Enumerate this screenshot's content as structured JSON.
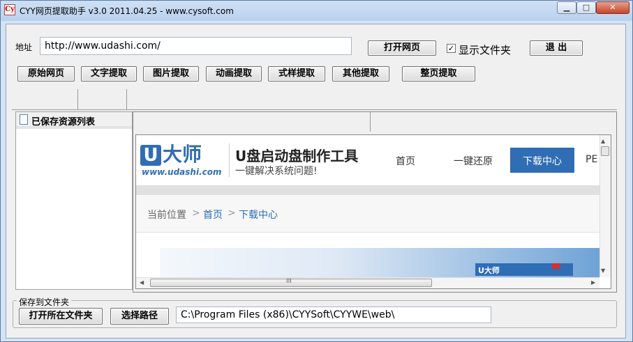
{
  "window": {
    "title": "CYY网页提取助手 v3.0 2011.04.25 - www.cysoft.com",
    "app_icon": "Cy",
    "min": "▁",
    "max": "□",
    "close": "✕"
  },
  "address": {
    "label": "地址",
    "value": "http://www.udashi.com/",
    "open_button": "打开网页",
    "show_folder_label": "显示文件夹",
    "show_folder_checked": true,
    "exit_button": "退 出"
  },
  "toolbar": [
    "原始网页",
    "文字提取",
    "图片提取",
    "动画提取",
    "式样提取",
    "其他提取",
    "整页提取"
  ],
  "left_panel": {
    "title": "已保存资源列表"
  },
  "web": {
    "logo_mark": "U",
    "logo_text": "大师",
    "logo_url": "www.udashi.com",
    "headline": "U盘启动盘制作工具",
    "subline": "一键解决系统问题!",
    "nav": [
      "首页",
      "一键还原",
      "下载中心",
      "PE"
    ],
    "breadcrumb": {
      "prefix": "当前位置",
      "sep": ">",
      "home": "首页",
      "current": "下载中心"
    },
    "mini_logo": "U大师",
    "hscroll_grip": "III"
  },
  "save": {
    "group_label": "保存到文件夹",
    "open_folder_button": "打开所在文件夹",
    "choose_path_button": "选择路径",
    "path_value": "C:\\Program Files (x86)\\CYYSoft\\CYYWE\\web\\"
  },
  "colors": {
    "accent": "#2f6db5",
    "nav_active": "#2f6db5",
    "link": "#2a6db5"
  }
}
